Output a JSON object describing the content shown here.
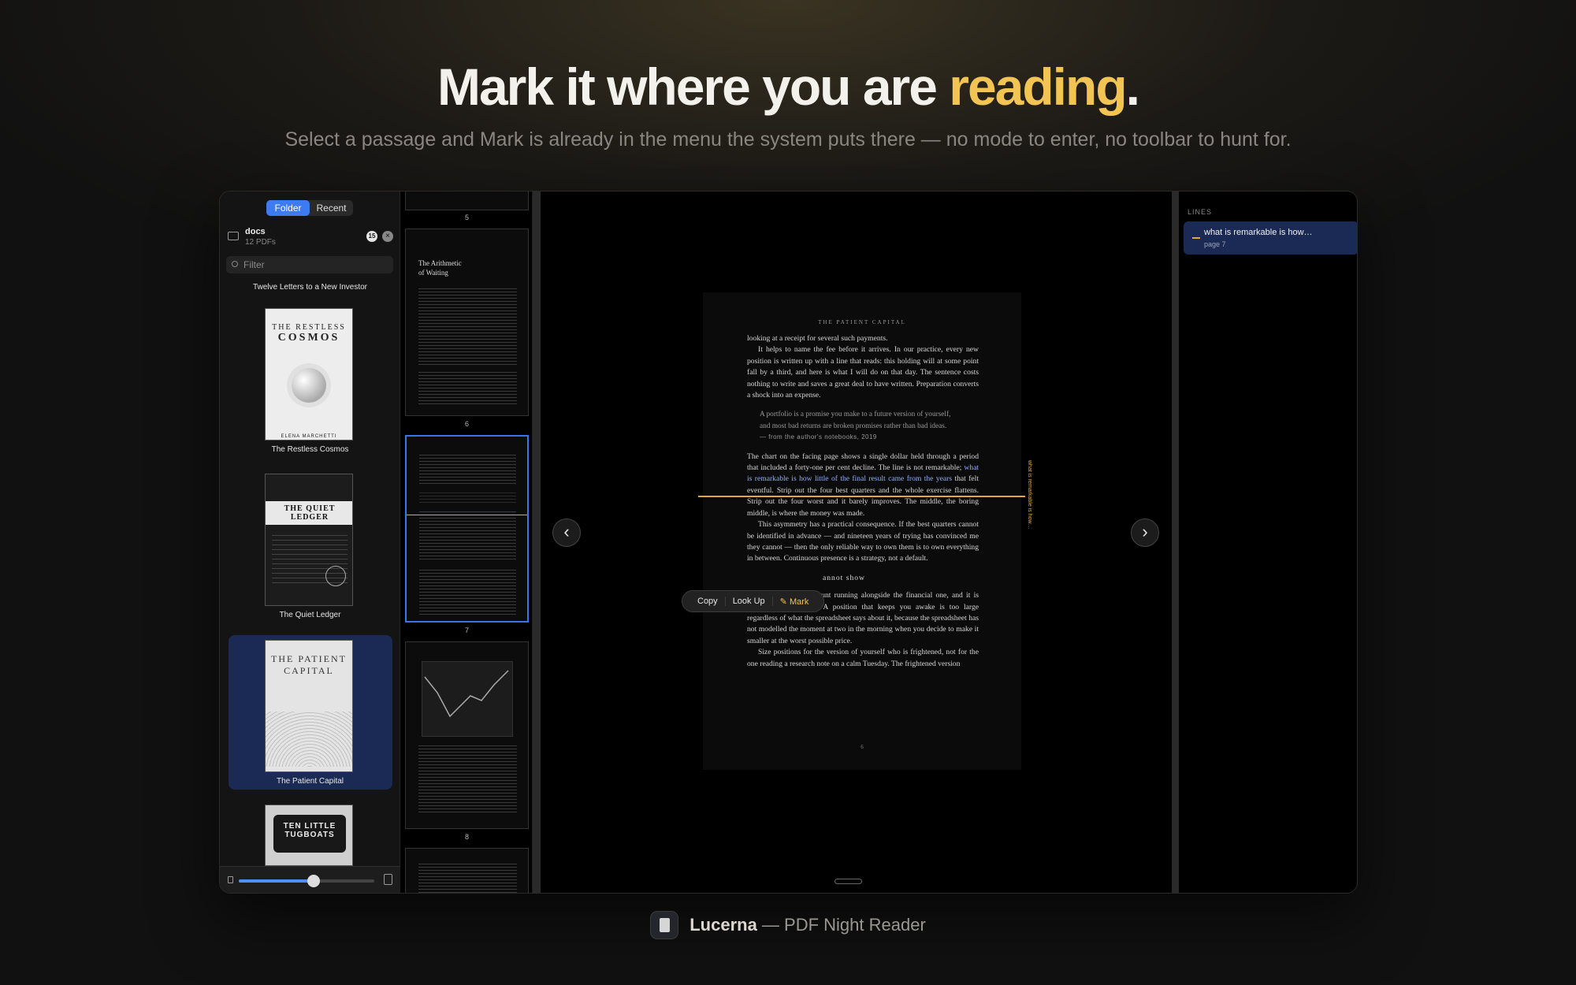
{
  "hero": {
    "headline_pre": "Mark it where you are ",
    "headline_accent": "reading",
    "headline_post": ".",
    "subhead": "Select a passage and Mark is already in the menu the system puts there — no mode to enter, no toolbar to hunt for."
  },
  "sidebar": {
    "tabs": [
      "Folder",
      "Recent"
    ],
    "active_tab": "Folder",
    "folder": {
      "name": "docs",
      "count": "12 PDFs",
      "badge": "15"
    },
    "filter_placeholder": "Filter",
    "shelf_heading": "Twelve Letters to a New Investor",
    "books": [
      {
        "title": "The Restless Cosmos",
        "cover_title": [
          "THE RESTLESS",
          "COSMOS"
        ],
        "cover_author": "ELENA MARCHETTI"
      },
      {
        "title": "The Quiet Ledger",
        "cover_title": [
          "THE QUIET",
          "LEDGER"
        ]
      },
      {
        "title": "The Patient Capital",
        "cover_title": [
          "THE PATIENT",
          "CAPITAL"
        ],
        "selected": true
      },
      {
        "title": "Ten Little Tugboats",
        "cover_title": [
          "TEN LITTLE",
          "TUGBOATS"
        ]
      }
    ],
    "zoom_fraction": 0.55
  },
  "thumbnails": {
    "pages": [
      "5",
      "6",
      "7",
      "8"
    ],
    "current_page": "7",
    "page6_title": [
      "The Arithmetic",
      "of Waiting"
    ]
  },
  "reader": {
    "running_head": "THE PATIENT CAPITAL",
    "p1": "looking at a receipt for several such payments.",
    "p2": "It helps to name the fee before it arrives. In our practice, every new position is written up with a line that reads: this holding will at some point fall by a third, and here is what I will do on that day. The sentence costs nothing to write and saves a great deal to have written. Preparation converts a shock into an expense.",
    "quote_line1": "A portfolio is a promise you make to a future version of yourself,",
    "quote_line2": "and most bad returns are broken promises rather than bad ideas.",
    "quote_attrib": "— from the author's notebooks, 2019",
    "p3_pre": "The chart on the facing page shows a single dollar held through a period that included a forty-one per cent decline. The line is not remarkable; ",
    "p3_hl": "what is remarkable is how little of the final result came from the years",
    "p3_post": " that felt eventful. Strip out the four best quarters and the whole exercise flattens. Strip out the four worst and it barely improves. The middle, the boring middle, is where the money was made.",
    "p4": "This asymmetry has a practical consequence. If the best quarters cannot be identified in advance — and nineteen years of trying has convinced me they cannot — then the only reliable way to own them is to own everything in between. Continuous presence is a strategy, not a default.",
    "section_title": "annot show",
    "p5": "There is a second account running alongside the financial one, and it is denominated in sleep. A position that keeps you awake is too large regardless of what the spreadsheet says about it, because the spreadsheet has not modelled the moment at two in the morning when you decide to make it smaller at the worst possible price.",
    "p6": "Size positions for the version of yourself who is frightened, not for the one reading a research note on a calm Tuesday. The frightened version",
    "page_number": "6",
    "margin_note": "what is remarkable is how…",
    "context_menu": [
      "Copy",
      "Look Up",
      "Mark"
    ],
    "nav_prev": "‹",
    "nav_next": "›"
  },
  "lines_panel": {
    "heading": "LINES",
    "items": [
      {
        "text": "what is remarkable is how…",
        "page": "page 7"
      }
    ]
  },
  "brand": {
    "name": "Lucerna",
    "tagline": " — PDF Night Reader"
  },
  "colors": {
    "accent": "#f2c453",
    "highlight": "#e0a93a",
    "selection": "#1b2a55",
    "tab_active": "#3d7cf0"
  }
}
